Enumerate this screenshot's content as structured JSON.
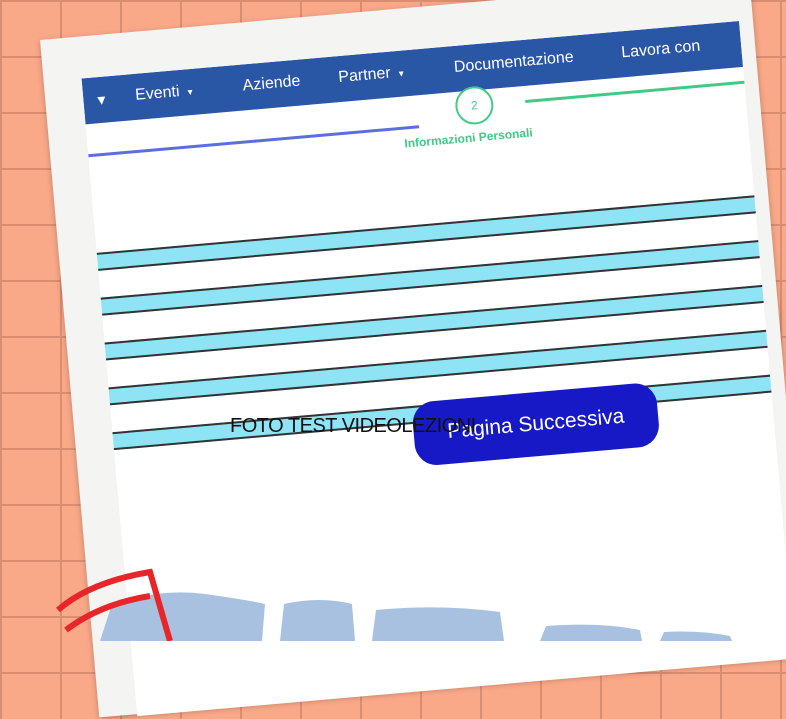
{
  "navbar": {
    "items": [
      {
        "label": "Eventi",
        "caret": "▾"
      },
      {
        "label": "Aziende"
      },
      {
        "label": "Partner",
        "caret": "▾"
      },
      {
        "label": "Documentazione"
      },
      {
        "label": "Lavora con"
      }
    ],
    "leading_caret": "▾",
    "color": "#2a56a6"
  },
  "stepper": {
    "current_step": "2",
    "current_label": "Informazioni Personali",
    "done_color": "#5b6ee0",
    "active_color": "#42c986"
  },
  "form": {
    "field_color": "#8ee3f5",
    "field_count": 5,
    "next_button": "Pagina Successiva",
    "button_color": "#1719c7"
  },
  "caption": "FOTO TEST VIDEOLEZIONI",
  "decor": {
    "background_color": "#f9a888",
    "grid_color": "#d98e72",
    "puzzle_color": "#a9c1e0",
    "marker_color": "#e8262a"
  }
}
